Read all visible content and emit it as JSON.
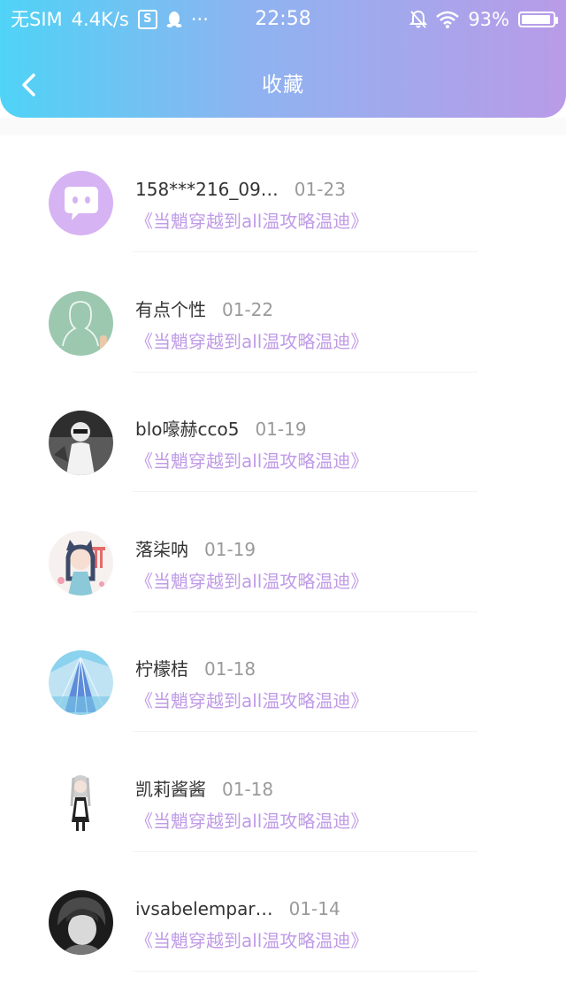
{
  "status_bar": {
    "carrier": "无SIM",
    "speed": "4.4K/s",
    "app_badge": "S",
    "more": "···",
    "time": "22:58",
    "battery": "93%",
    "battery_level": 0.93
  },
  "nav": {
    "title": "收藏",
    "back_icon": "chevron-left-icon"
  },
  "colors": {
    "header_gradient_start": "#4fd3f6",
    "header_gradient_end": "#b99be8",
    "book_link": "#c09be6",
    "name_text": "#333333",
    "date_text": "#9a9a9a"
  },
  "items": [
    {
      "name": "158***216_09…",
      "date": "01-23",
      "book": "《当魈穿越到all温攻略温迪》",
      "avatar": "default-chat-avatar"
    },
    {
      "name": "有点个性",
      "date": "01-22",
      "book": "《当魈穿越到all温攻略温迪》",
      "avatar": "green-chalk-avatar"
    },
    {
      "name": "blo嚎赫cco5",
      "date": "01-19",
      "book": "《当魈穿越到all温攻略温迪》",
      "avatar": "photo-avatar"
    },
    {
      "name": "落柒呐",
      "date": "01-19",
      "book": "《当魈穿越到all温攻略温迪》",
      "avatar": "anime-girl-avatar"
    },
    {
      "name": "柠檬桔",
      "date": "01-18",
      "book": "《当魈穿越到all温攻略温迪》",
      "avatar": "blue-abstract-avatar"
    },
    {
      "name": "凯莉酱酱",
      "date": "01-18",
      "book": "《当魈穿越到all温攻略温迪》",
      "avatar": "maid-figure-avatar"
    },
    {
      "name": "ivsabelempar…",
      "date": "01-14",
      "book": "《当魈穿越到all温攻略温迪》",
      "avatar": "dark-portrait-avatar"
    }
  ]
}
